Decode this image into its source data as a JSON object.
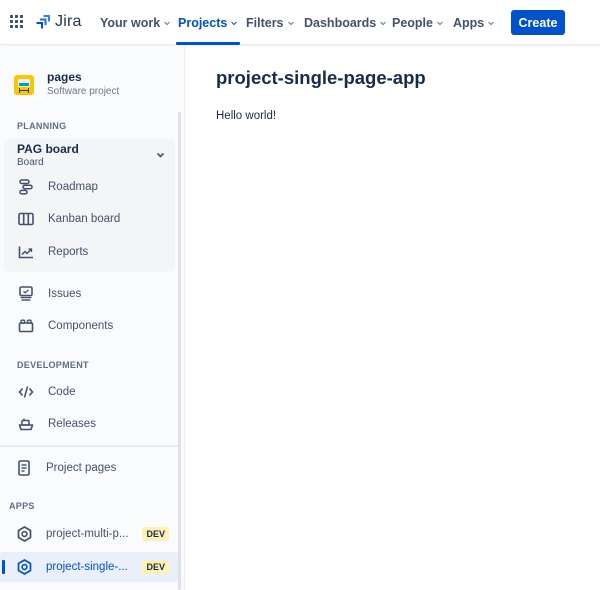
{
  "topnav": {
    "logo_text": "Jira",
    "items": [
      {
        "label": "Your work",
        "active": false
      },
      {
        "label": "Projects",
        "active": true
      },
      {
        "label": "Filters",
        "active": false
      },
      {
        "label": "Dashboards",
        "active": false
      },
      {
        "label": "People",
        "active": false
      },
      {
        "label": "Apps",
        "active": false
      }
    ],
    "create_label": "Create"
  },
  "sidebar": {
    "project": {
      "name": "pages",
      "type": "Software project"
    },
    "planning_label": "PLANNING",
    "board": {
      "name": "PAG board",
      "type": "Board"
    },
    "board_items": [
      {
        "label": "Roadmap",
        "icon": "roadmap-icon"
      },
      {
        "label": "Kanban board",
        "icon": "kanban-board-icon"
      },
      {
        "label": "Reports",
        "icon": "reports-icon"
      }
    ],
    "planning_items": [
      {
        "label": "Issues",
        "icon": "issues-icon"
      },
      {
        "label": "Components",
        "icon": "components-icon"
      }
    ],
    "development_label": "DEVELOPMENT",
    "development_items": [
      {
        "label": "Code",
        "icon": "code-icon"
      },
      {
        "label": "Releases",
        "icon": "releases-icon"
      }
    ],
    "project_pages_label": "Project pages",
    "apps_label": "APPS",
    "apps": [
      {
        "label": "project-multi-p...",
        "badge": "DEV",
        "active": false
      },
      {
        "label": "project-single-...",
        "badge": "DEV",
        "active": true
      }
    ]
  },
  "main": {
    "title": "project-single-page-app",
    "body": "Hello world!"
  },
  "colors": {
    "brand": "#0052cc",
    "badge_bg": "#fff0b3",
    "logo_yellow": "#ffc400"
  }
}
